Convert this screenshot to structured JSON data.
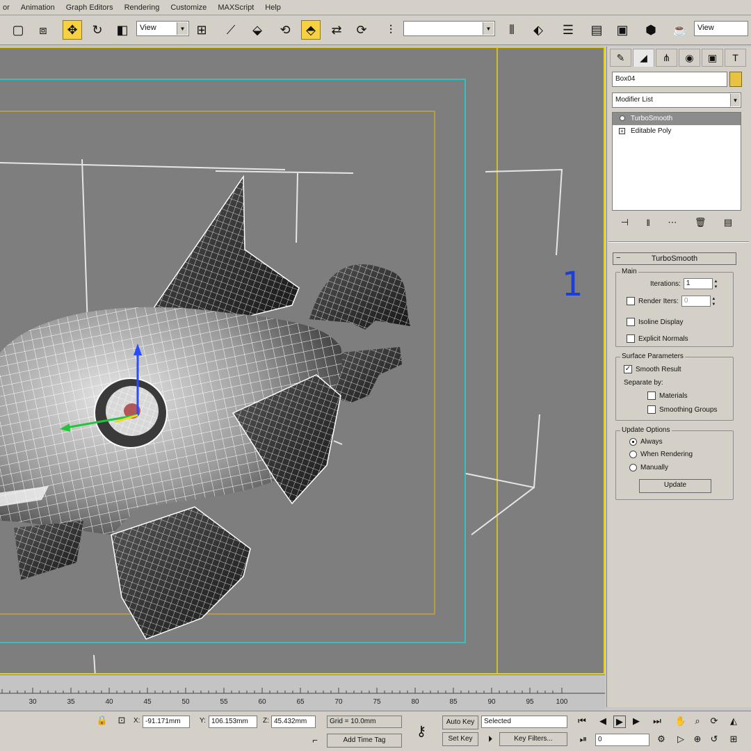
{
  "menu": [
    "or",
    "Animation",
    "Graph Editors",
    "Rendering",
    "Customize",
    "MAXScript",
    "Help"
  ],
  "toolbar": {
    "reference_coord": "View",
    "named_selection": "",
    "view_right": "View"
  },
  "viewport": {
    "label": "1"
  },
  "command_panel": {
    "object_name": "Box04",
    "modifier_list": "Modifier List",
    "stack": [
      "TurboSmooth",
      "Editable Poly"
    ],
    "rollout_title": "TurboSmooth",
    "main_group": "Main",
    "iterations_label": "Iterations:",
    "iterations_value": "1",
    "render_iters_label": "Render Iters:",
    "render_iters_value": "0",
    "isoline_label": "Isoline Display",
    "explicit_normals_label": "Explicit Normals",
    "surface_group": "Surface Parameters",
    "smooth_result_label": "Smooth Result",
    "separate_by_label": "Separate by:",
    "materials_label": "Materials",
    "smoothing_groups_label": "Smoothing Groups",
    "update_group": "Update Options",
    "always_label": "Always",
    "when_rendering_label": "When Rendering",
    "manually_label": "Manually",
    "update_button": "Update"
  },
  "timeline": {
    "ticks": [
      "30",
      "35",
      "40",
      "45",
      "50",
      "55",
      "60",
      "65",
      "70",
      "75",
      "80",
      "85",
      "90",
      "95",
      "100"
    ]
  },
  "status": {
    "x_label": "X:",
    "x_value": "-91.171mm",
    "y_label": "Y:",
    "y_value": "106.153mm",
    "z_label": "Z:",
    "z_value": "45.432mm",
    "grid": "Grid = 10.0mm",
    "add_time_tag": "Add Time Tag",
    "auto_key": "Auto Key",
    "selected": "Selected",
    "set_key": "Set Key",
    "key_filters": "Key Filters...",
    "frame": "0"
  },
  "colors": {
    "viewport_border": "#e9d400",
    "safe_frame_outer": "#27c6c6",
    "safe_frame_inner": "#c9a43a",
    "label_blue": "#1a3fd8",
    "active_tool": "#f7d142"
  }
}
